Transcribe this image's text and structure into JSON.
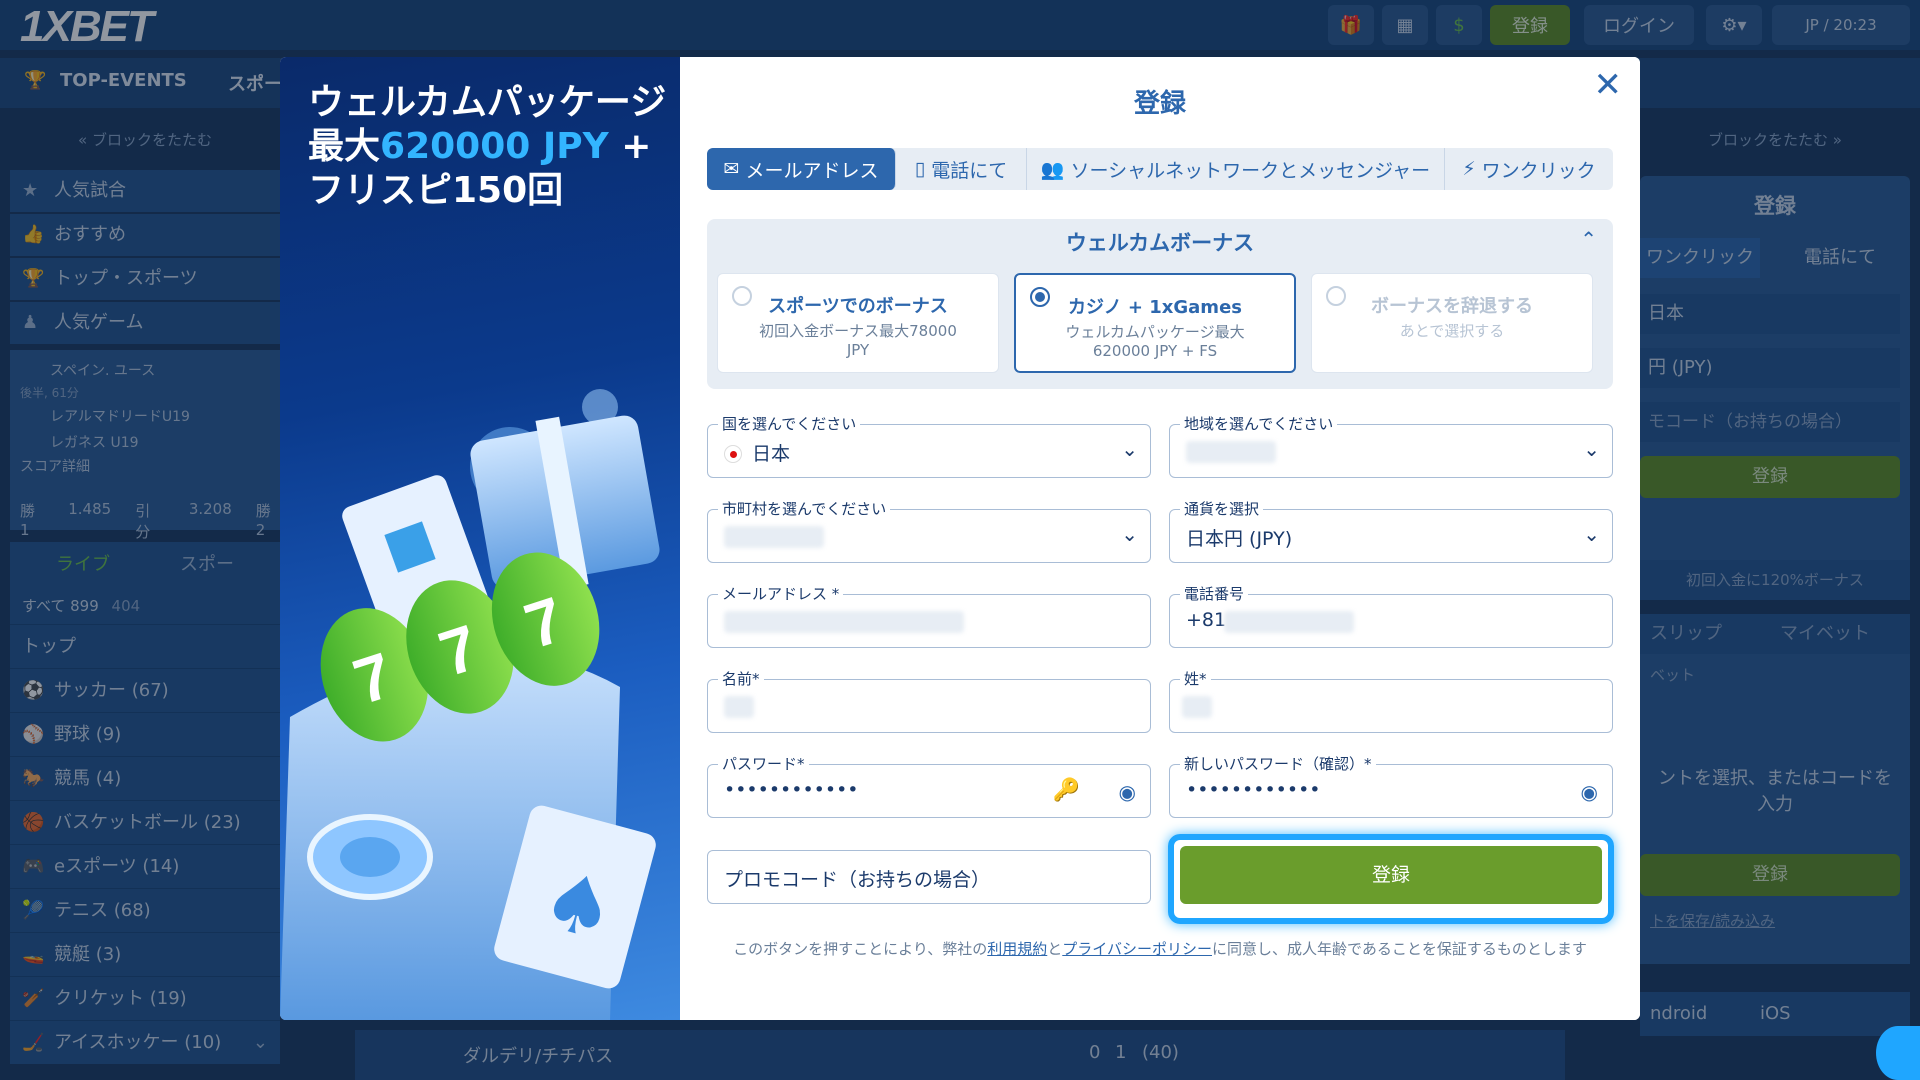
{
  "app": {
    "logo": "1XBET"
  },
  "topbar": {
    "register": "登録",
    "login": "ログイン",
    "locale": "JP / 20:23"
  },
  "nav": {
    "top_events": "TOP-EVENTS",
    "sports": "スポー"
  },
  "left": {
    "collapse": "« ブロックをたたむ",
    "menu": [
      "人気試合",
      "おすすめ",
      "トップ・スポーツ",
      "人気ゲーム"
    ],
    "match": {
      "league": "スペイン. ユース",
      "time": "後半, 61分",
      "team1": "レアルマドリードU19",
      "team2": "レガネス U19",
      "details": "スコア詳細",
      "odds": [
        "勝1",
        "1.485",
        "引分",
        "3.208",
        "勝2"
      ]
    },
    "live_tabs": [
      "ライブ",
      "スポー"
    ],
    "all": "すべて 899",
    "all_count": "404",
    "top": "トップ",
    "sports": [
      "サッカー (67)",
      "野球 (9)",
      "競馬 (4)",
      "バスケットボール (23)",
      "eスポーツ (14)",
      "テニス (68)",
      "競艇 (3)",
      "クリケット (19)",
      "アイスホッケー (10)"
    ]
  },
  "right": {
    "collapse": "ブロックをたたむ »",
    "title": "登録",
    "tabs": [
      "ワンクリック",
      "電話にて"
    ],
    "country": "日本",
    "currency": "円 (JPY)",
    "promo": "モコード（お持ちの場合）",
    "register": "登録",
    "bonus": "初回入金に120%ボーナス",
    "slip_tabs": [
      "スリップ",
      "マイベット"
    ],
    "slip_label": "ベット",
    "slip_empty": "ントを選択、またはコードを入力",
    "slip_register": "登録",
    "save": "トを保存/読み込み",
    "apps": [
      "ndroid",
      "iOS"
    ]
  },
  "bottom": {
    "match": "ダルデリ/チチパス",
    "s1": "0",
    "s2": "1",
    "s3": "(40)"
  },
  "promo": {
    "title_a": "ウェルカムパッケージ 最大",
    "title_hl": "620000 JPY",
    "title_b": " + フリスピ150回"
  },
  "form": {
    "title": "登録",
    "tabs": [
      {
        "label": "メールアドレス",
        "icon": "envelope-icon"
      },
      {
        "label": "電話にて",
        "icon": "phone-icon"
      },
      {
        "label": "ソーシャルネットワークとメッセンジャー",
        "icon": "users-icon"
      },
      {
        "label": "ワンクリック",
        "icon": "lightning-icon"
      }
    ],
    "bonus": {
      "title": "ウェルカムボーナス",
      "options": [
        {
          "name": "スポーツでのボーナス",
          "desc": "初回入金ボーナス最大78000 JPY"
        },
        {
          "name": "カジノ + 1xGames",
          "desc": "ウェルカムパッケージ最大 620000 JPY + FS"
        },
        {
          "name": "ボーナスを辞退する",
          "desc": "あとで選択する"
        }
      ]
    },
    "country_label": "国を選んでください",
    "country_value": "日本",
    "region_label": "地域を選んでください",
    "city_label": "市町村を選んでください",
    "currency_label": "通貨を選択",
    "currency_value": "日本円 (JPY)",
    "email_label": "メールアドレス *",
    "phone_label": "電話番号",
    "phone_prefix": "+81",
    "firstname_label": "名前*",
    "lastname_label": "姓*",
    "password_label": "パスワード*",
    "password_value": "••••••••••••",
    "confirm_label": "新しいパスワード（確認）*",
    "confirm_value": "••••••••••••",
    "promo_placeholder": "プロモコード（お持ちの場合）",
    "register": "登録",
    "disclaimer_a": "このボタンを押すことにより、弊社の",
    "terms": "利用規約",
    "disclaimer_b": "と",
    "privacy": "プライバシーポリシー",
    "disclaimer_c": "に同意し、成人年齢であることを保証するものとします"
  },
  "colors": {
    "accent": "#2d67ad",
    "green": "#6a9d2c",
    "highlight": "#1fa6ff"
  }
}
